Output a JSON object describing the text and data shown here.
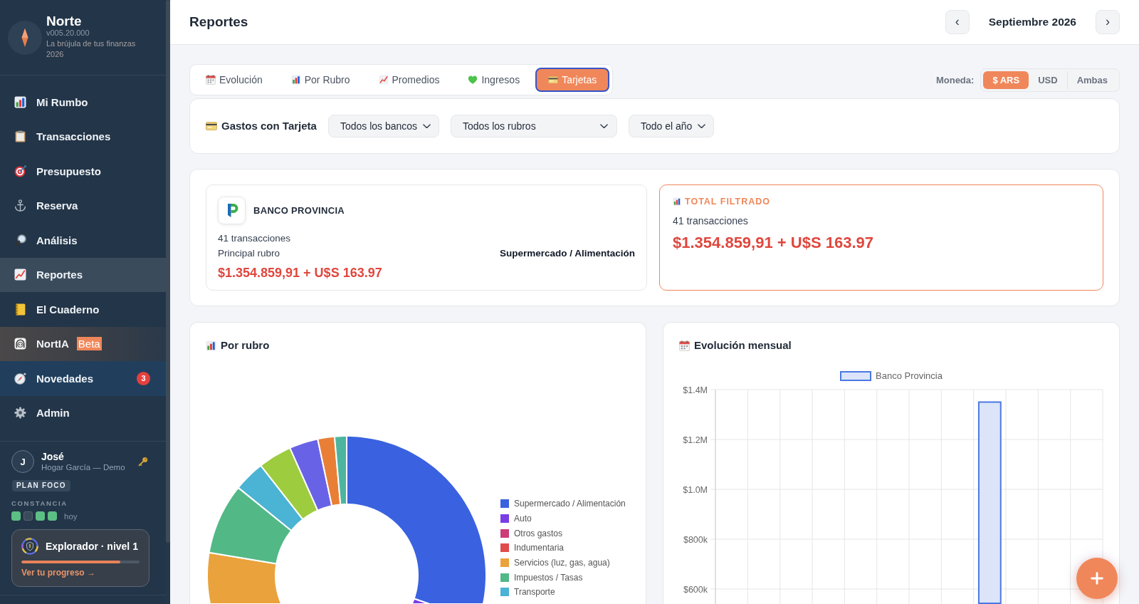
{
  "sidebar": {
    "brand": {
      "name": "Norte",
      "version": "v005.20.000",
      "tagline": "La brújula de tus finanzas",
      "year": "2026"
    },
    "items": [
      {
        "label": "Mi Rumbo",
        "kind": "plain",
        "selected": false
      },
      {
        "label": "Transacciones",
        "kind": "plain",
        "selected": false
      },
      {
        "label": "Presupuesto",
        "kind": "plain",
        "selected": false
      },
      {
        "label": "Reserva",
        "kind": "plain",
        "selected": false
      },
      {
        "label": "Análisis",
        "kind": "plain",
        "selected": false
      },
      {
        "label": "Reportes",
        "kind": "plain",
        "selected": true
      },
      {
        "label": "El Cuaderno",
        "kind": "plain",
        "selected": false
      },
      {
        "label": "NortIA",
        "kind": "featured",
        "selected": false,
        "tag": "Beta"
      },
      {
        "label": "Novedades",
        "kind": "notice",
        "selected": false,
        "count": "3"
      },
      {
        "label": "Admin",
        "kind": "plain",
        "selected": false
      }
    ],
    "user": {
      "initial": "J",
      "name": "José",
      "household": "Hogar García — Demo",
      "plan": "PLAN FOCO"
    },
    "streak": {
      "label": "CONSTANCIA",
      "days": [
        {
          "done": true
        },
        {
          "done": false
        },
        {
          "done": true
        },
        {
          "done": true
        }
      ],
      "caption": "hoy"
    },
    "level_card": {
      "title": "Explorador · nivel 1",
      "level": 0.84,
      "link": "Ver tu progreso →"
    }
  },
  "header": {
    "title": "Reportes",
    "prev": "‹",
    "period": "Septiembre 2026",
    "next": "›"
  },
  "tabs": [
    {
      "label": "Evolución",
      "selected": false
    },
    {
      "label": "Por Rubro",
      "selected": false
    },
    {
      "label": "Promedios",
      "selected": false
    },
    {
      "label": "Ingresos",
      "selected": false
    },
    {
      "label": "Tarjetas",
      "selected": true
    }
  ],
  "currency": {
    "label": "Moneda:",
    "options": [
      {
        "label": "$ ARS",
        "selected": true
      },
      {
        "label": "USD",
        "selected": false
      },
      {
        "label": "Ambas",
        "selected": false
      }
    ]
  },
  "filters": {
    "title": "Gastos con Tarjeta",
    "selects": [
      {
        "value": "Todos los bancos"
      },
      {
        "value": "Todos los rubros"
      },
      {
        "value": "Todo el año"
      }
    ]
  },
  "summary": {
    "bank": {
      "name": "BANCO PROVINCIA",
      "count": "41 transacciones",
      "top_label": "Principal rubro",
      "top_value": "Supermercado / Alimentación",
      "amount": "$1.354.859,91 + U$S 163.97"
    },
    "total": {
      "title": "TOTAL FILTRADO",
      "count": "41 transacciones",
      "amount": "$1.354.859,91 + U$S 163.97"
    }
  },
  "charts": {
    "by_category": {
      "title": "Por rubro",
      "legend": [
        {
          "label": "Supermercado / Alimentación",
          "color": "#3a62e0"
        },
        {
          "label": "Auto",
          "color": "#7a3ee6"
        },
        {
          "label": "Otros gastos",
          "color": "#cc3d78"
        },
        {
          "label": "Indumentaria",
          "color": "#e04b4b"
        },
        {
          "label": "Servicios (luz, gas, agua)",
          "color": "#eaa23c"
        },
        {
          "label": "Impuestos / Tasas",
          "color": "#52b886"
        },
        {
          "label": "Transporte",
          "color": "#4bb3d3"
        }
      ]
    },
    "monthly": {
      "title": "Evolución mensual",
      "chart_data": {
        "type": "bar",
        "grid": true,
        "series": [
          {
            "name": "Banco Provincia",
            "color": "#dbe4f9",
            "values": [
              null,
              null,
              null,
              null,
              null,
              null,
              null,
              null,
              1350000,
              null,
              null,
              null
            ]
          }
        ],
        "ylim": [
          540000,
          1400000
        ],
        "yticks": [
          {
            "value": 600000,
            "label": "$600k"
          },
          {
            "value": 800000,
            "label": "$800k"
          },
          {
            "value": 1000000,
            "label": "$1.0M"
          },
          {
            "value": 1200000,
            "label": "$1.2M"
          },
          {
            "value": 1400000,
            "label": "$1.4M"
          }
        ]
      }
    }
  }
}
